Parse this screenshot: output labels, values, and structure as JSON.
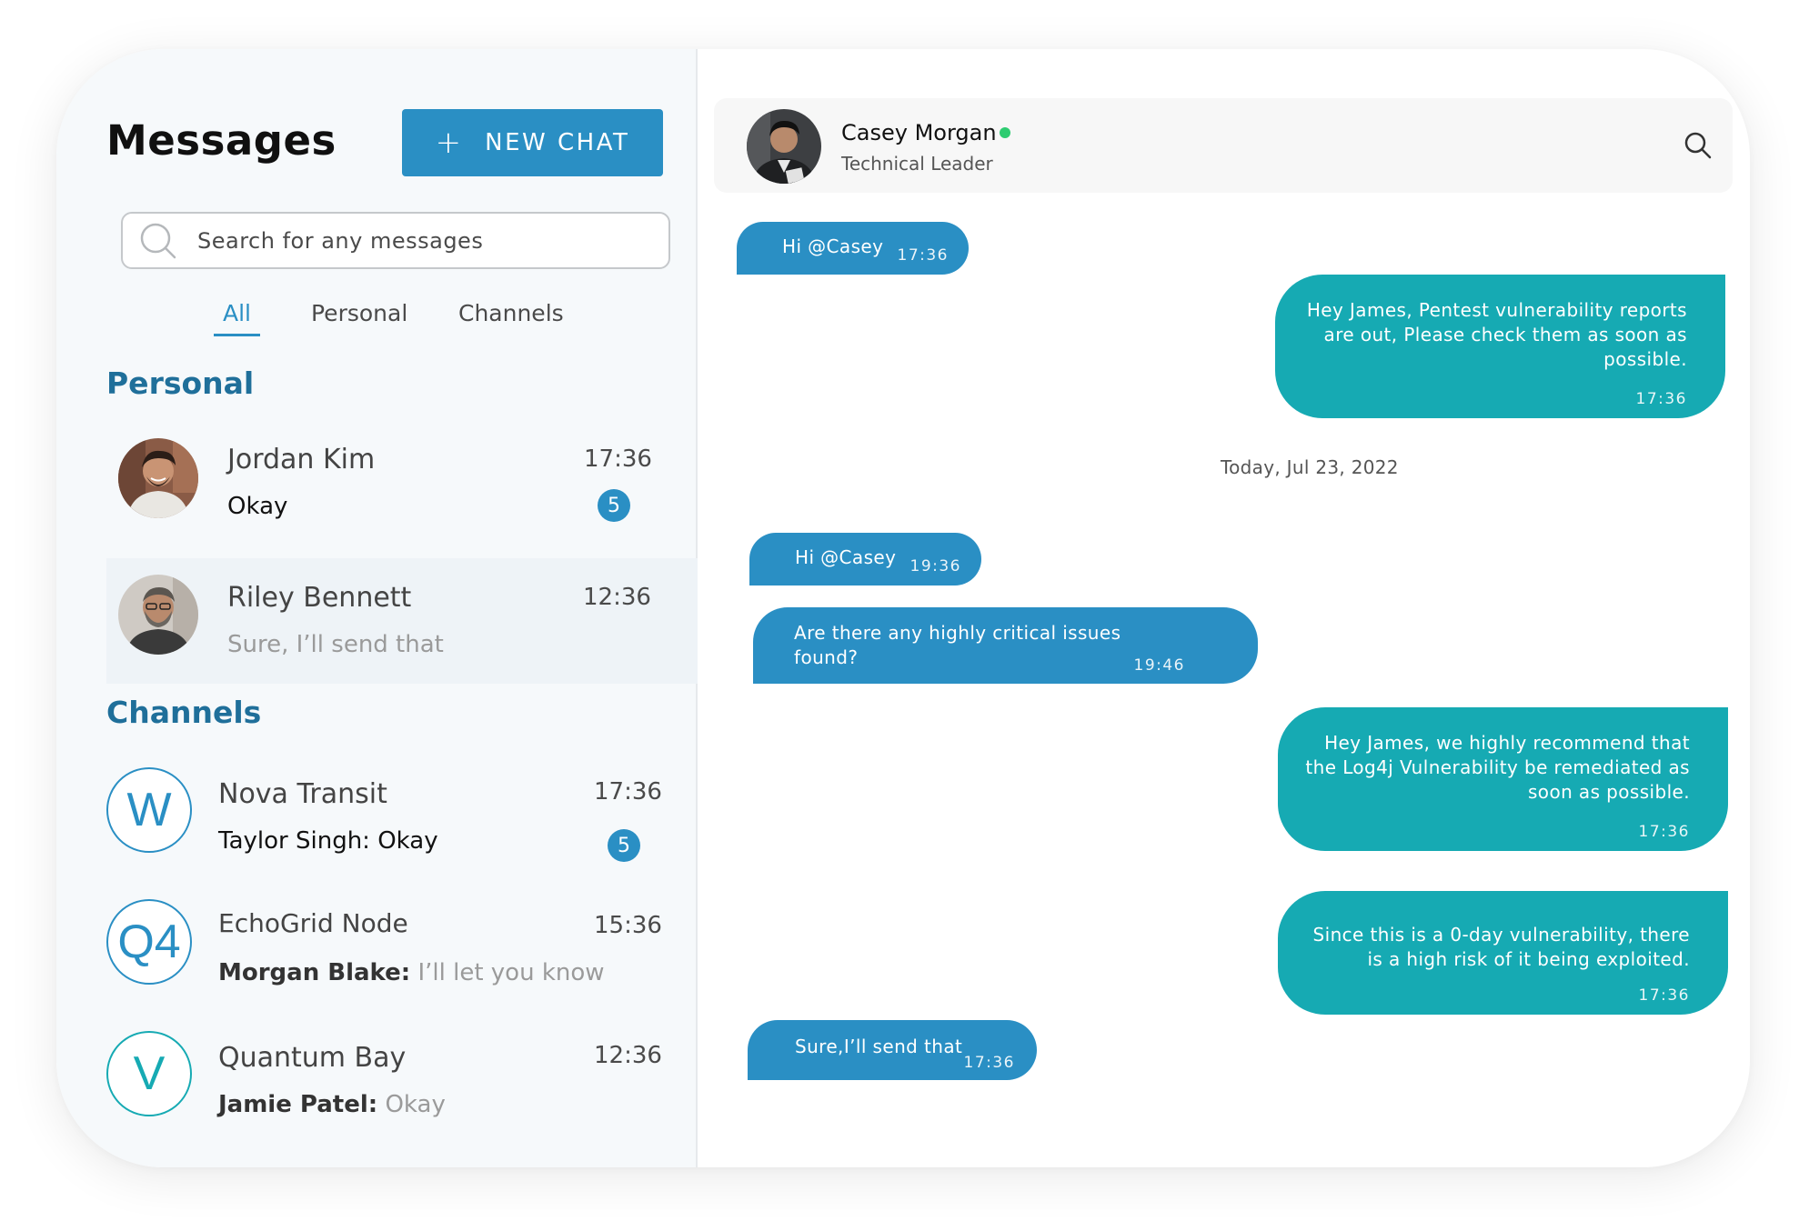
{
  "sidebar": {
    "title": "Messages",
    "new_chat_label": "NEW CHAT",
    "search_placeholder": "Search for any messages",
    "tabs": [
      "All",
      "Personal",
      "Channels"
    ],
    "active_tab": "All",
    "personal_heading": "Personal",
    "channels_heading": "Channels",
    "personal": [
      {
        "name": "Jordan Kim",
        "preview": "Okay",
        "time": "17:36",
        "unread": "5"
      },
      {
        "name": "Riley Bennett",
        "preview": "Sure, I’ll send that",
        "time": "12:36"
      }
    ],
    "channels": [
      {
        "initial": "W",
        "name": "Nova Transit",
        "author": "Taylor Singh:",
        "preview": "Okay",
        "time": "17:36",
        "unread": "5"
      },
      {
        "initial": "Q4",
        "name": "EchoGrid Node",
        "author": "Morgan Blake:",
        "preview": "I’ll let you know",
        "time": "15:36"
      },
      {
        "initial": "V",
        "name": "Quantum Bay",
        "author": "Jamie Patel:",
        "preview": "Okay",
        "time": "12:36"
      }
    ]
  },
  "conversation": {
    "contact_name": "Casey Morgan",
    "contact_role": "Technical Leader",
    "online": true,
    "date_separator": "Today, Jul 23, 2022",
    "messages": [
      {
        "dir": "in",
        "lines": [
          "Hi @Casey"
        ],
        "time": "17:36"
      },
      {
        "dir": "out",
        "lines": [
          "Hey James, Pentest vulnerability reports",
          "are out, Please check them as soon as",
          "possible."
        ],
        "time": "17:36"
      },
      {
        "dir": "in",
        "lines": [
          "Hi @Casey"
        ],
        "time": "19:36"
      },
      {
        "dir": "in",
        "lines": [
          "Are there any highly critical issues",
          "found?"
        ],
        "time": "19:46"
      },
      {
        "dir": "out",
        "lines": [
          "Hey James, we highly recommend that",
          "the Log4j Vulnerability be remediated as",
          "soon as possible."
        ],
        "time": "17:36"
      },
      {
        "dir": "out",
        "lines": [
          "Since this is a 0-day vulnerability, there",
          "is a high risk of it being exploited."
        ],
        "time": "17:36"
      },
      {
        "dir": "in",
        "lines": [
          "Sure,I’ll send that"
        ],
        "time": "17:36"
      }
    ]
  },
  "colors": {
    "primary_blue": "#2a8fc4",
    "teal": "#16aab3",
    "section_heading": "#1f6f9a",
    "online": "#2ecc71"
  },
  "icons": [
    "search-icon",
    "plus-icon",
    "online-status-dot"
  ]
}
